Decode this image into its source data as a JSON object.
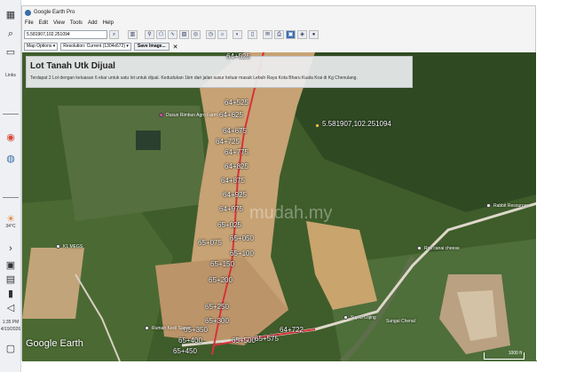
{
  "window": {
    "title": "Google Earth Pro",
    "minimize": "–",
    "maximize": "▢",
    "close": "✕"
  },
  "menu": [
    "File",
    "Edit",
    "View",
    "Tools",
    "Add",
    "Help"
  ],
  "search": {
    "value": "5.581907,102.251094"
  },
  "options": {
    "map_options": "Map Options ▾",
    "resolution": "Resolution: Current (1304x672) ▾",
    "save_image": "Save Image...",
    "close": "✕"
  },
  "info": {
    "title": "Lot Tanah Utk Dijual",
    "description": "Terdapat 2 Lot dengan keluasan 6 ekar untuk satu lot untuk dijual. Kedudukan 1km dari jalan susur keluar masuk Lebuh Raya Kota Bharu Kuala Krai di Kg Chenulang."
  },
  "taskbar": {
    "links_label": "Links",
    "temperature": "34°C",
    "time": "1:35 PM",
    "date": "4/19/2026"
  },
  "map": {
    "coordinate_pin": "5.581907,102.251094",
    "places": [
      "Dusun Rimbun Agro Farm",
      "K1 MEGS",
      "Rumah Kecil Samo",
      "Roti canai cheese",
      "Rabbit Resources",
      "Sup D Lojing",
      "Sungai Chenal"
    ],
    "watermark": "mudah.my",
    "logo": "Google Earth",
    "scale": "1000 ft",
    "lot_labels": [
      "64+525",
      "64+625",
      "64+675",
      "64+725",
      "64+775",
      "64+825",
      "64+875",
      "64+925",
      "64+975",
      "65+025",
      "65+075",
      "65+050",
      "65+100",
      "65+150",
      "65+200",
      "65+250",
      "65+300",
      "65+350",
      "65+400",
      "65+450",
      "65+500",
      "65+550",
      "64+722",
      "65+575"
    ]
  },
  "colors": {
    "accent": "#3b6fb6",
    "forest": "#3c5a2a",
    "clearing": "#c9a577",
    "road": "#e8e2d6"
  }
}
